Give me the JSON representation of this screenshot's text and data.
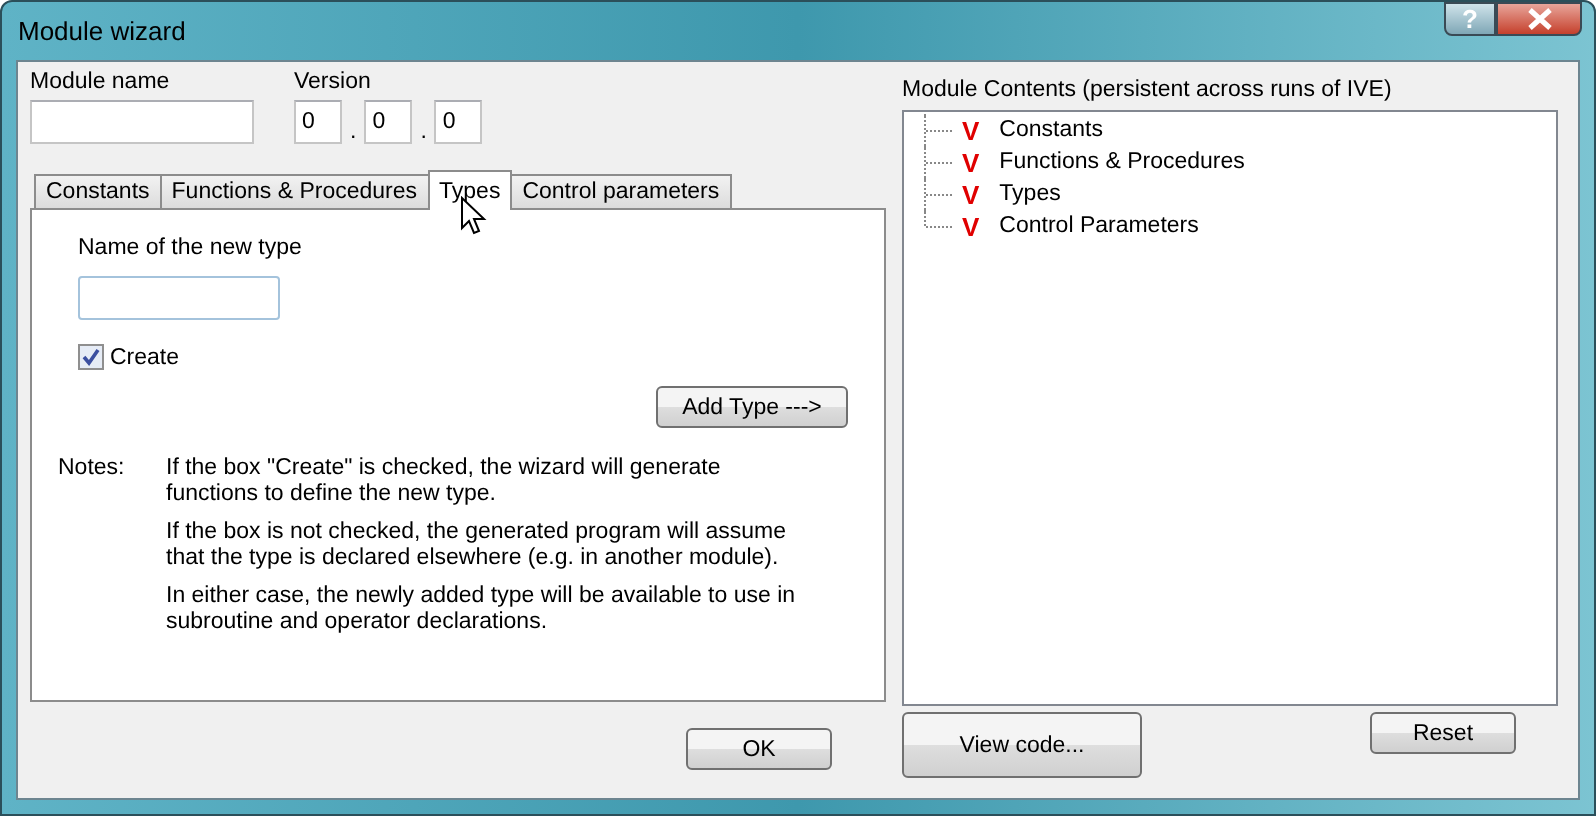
{
  "window": {
    "title": "Module wizard",
    "help_button": "?"
  },
  "module_name": {
    "label": "Module name"
  },
  "version": {
    "label": "Version",
    "parts": [
      "0",
      "0",
      "0"
    ],
    "separators": [
      ".",
      "."
    ]
  },
  "tabs": [
    {
      "label": "Constants",
      "selected": false
    },
    {
      "label": "Functions & Procedures",
      "selected": false
    },
    {
      "label": "Types",
      "selected": true
    },
    {
      "label": "Control parameters",
      "selected": false
    }
  ],
  "types_panel": {
    "name_label": "Name of the new type",
    "create": {
      "label": "Create",
      "checked": true
    },
    "add_button": "Add Type --->",
    "notes_label": "Notes:",
    "notes": [
      "If the box \"Create\" is checked, the wizard will generate functions to define the new type.",
      "If the box is not checked, the generated program will assume that the type is declared elsewhere (e.g. in another module).",
      "In either case, the newly added type will be available to use in subroutine and operator declarations."
    ]
  },
  "ok_button": "OK",
  "module_contents": {
    "label": "Module Contents (persistent across runs of IVE)",
    "items": [
      {
        "mark": "V",
        "label": "Constants"
      },
      {
        "mark": "V",
        "label": "Functions & Procedures"
      },
      {
        "mark": "V",
        "label": "Types"
      },
      {
        "mark": "V",
        "label": "Control Parameters"
      }
    ]
  },
  "view_code_button": "View code...",
  "reset_button": "Reset"
}
